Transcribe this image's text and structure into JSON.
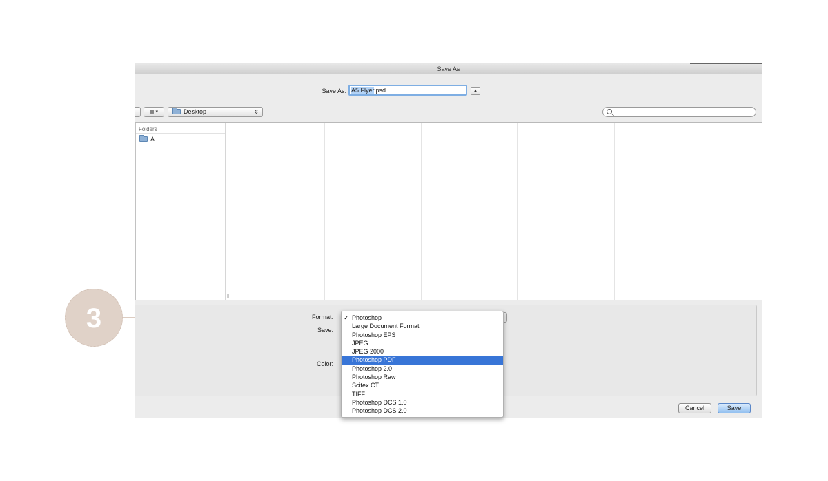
{
  "step": {
    "number": "3",
    "color": "#e0d2c8"
  },
  "window": {
    "title": "Save As",
    "save_as_label": "Save As:",
    "filename": "A5 Flyer",
    "extension": ".psd",
    "expand_icon": "triangle-up-icon"
  },
  "toolbar": {
    "view_icon": "grid-view-icon",
    "location": "Desktop",
    "search_placeholder": ""
  },
  "sidebar": {
    "header": "Folders",
    "items": [
      {
        "label": "A",
        "icon": "folder-icon"
      }
    ]
  },
  "options": {
    "format_label": "Format:",
    "save_label": "Save:",
    "color_label": "Color:"
  },
  "format_menu": {
    "checked_index": 0,
    "selected_index": 5,
    "check_mark": "✓",
    "items": [
      "Photoshop",
      "Large Document Format",
      "Photoshop EPS",
      "JPEG",
      "JPEG 2000",
      "Photoshop PDF",
      "Photoshop 2.0",
      "Photoshop Raw",
      "Scitex CT",
      "TIFF",
      "Photoshop DCS 1.0",
      "Photoshop DCS 2.0"
    ],
    "highlight_color": "#3875d7"
  },
  "buttons": {
    "cancel": "Cancel",
    "save": "Save"
  }
}
